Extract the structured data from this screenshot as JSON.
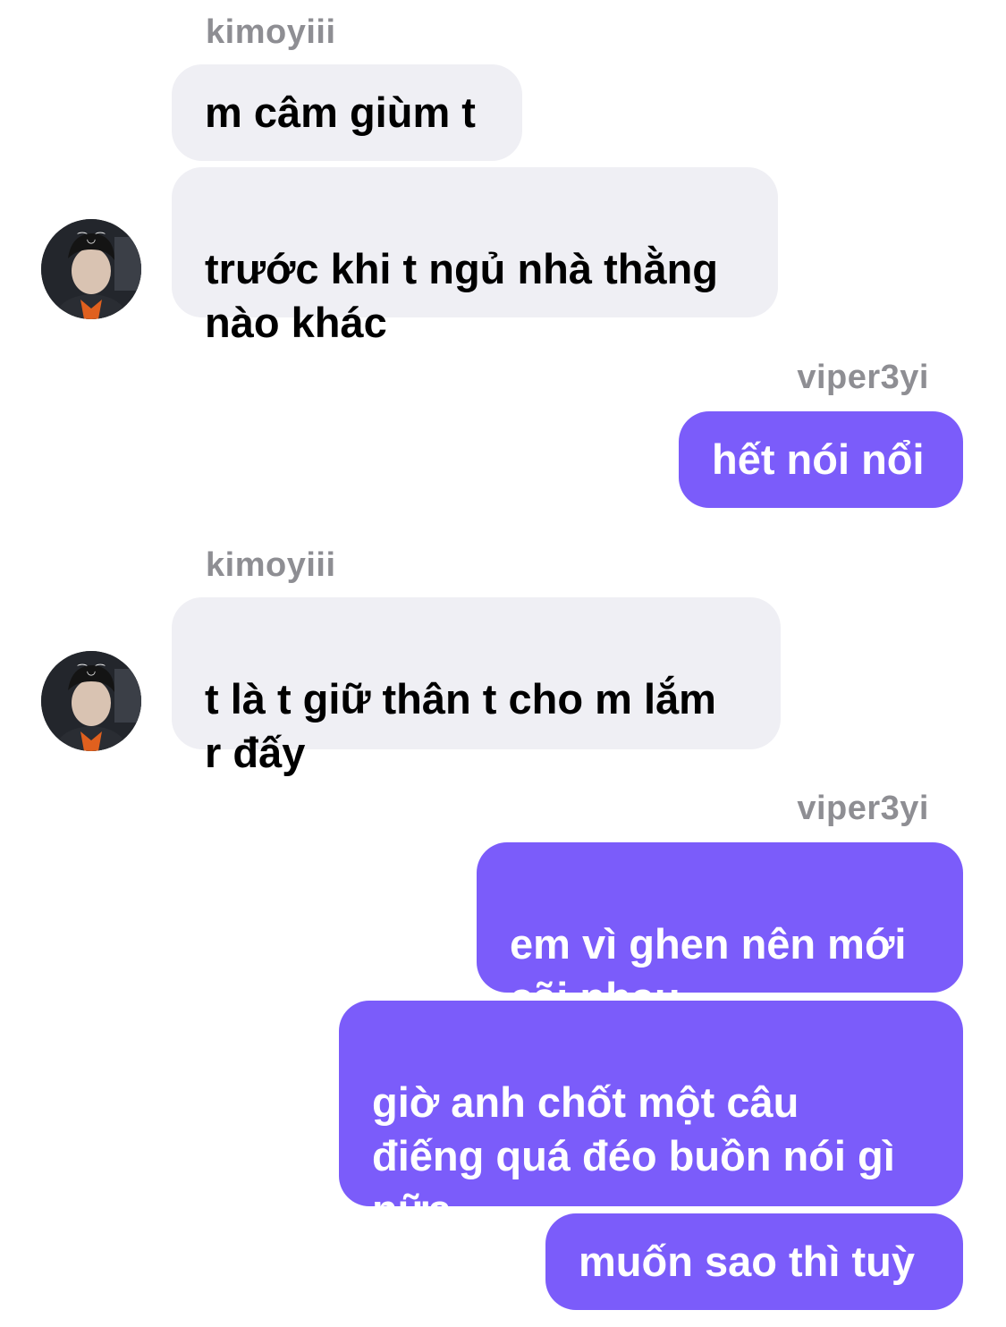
{
  "conversation": {
    "groups": [
      {
        "sender": "kimoyiii",
        "direction": "incoming",
        "messages": [
          "m câm giùm t",
          "trước khi t ngủ nhà thằng\nnào khác"
        ],
        "avatar_icon": "profile-photo-icon"
      },
      {
        "sender": "viper3yi",
        "direction": "outgoing",
        "messages": [
          "hết nói nổi"
        ]
      },
      {
        "sender": "kimoyiii",
        "direction": "incoming",
        "messages": [
          "t là t giữ thân t cho m lắm\nr đấy"
        ],
        "avatar_icon": "profile-photo-icon"
      },
      {
        "sender": "viper3yi",
        "direction": "outgoing",
        "messages": [
          "em vì ghen nên mới\ncãi nhau",
          "giờ anh chốt một câu\nđiếng quá đéo buồn nói gì\nnữa",
          "muốn sao thì tuỳ"
        ]
      }
    ]
  },
  "colors": {
    "incoming_bubble": "#efeff4",
    "outgoing_bubble": "#7b5cfa",
    "sender_label": "#8e8e93",
    "outgoing_text": "#ffffff",
    "incoming_text": "#000000"
  }
}
